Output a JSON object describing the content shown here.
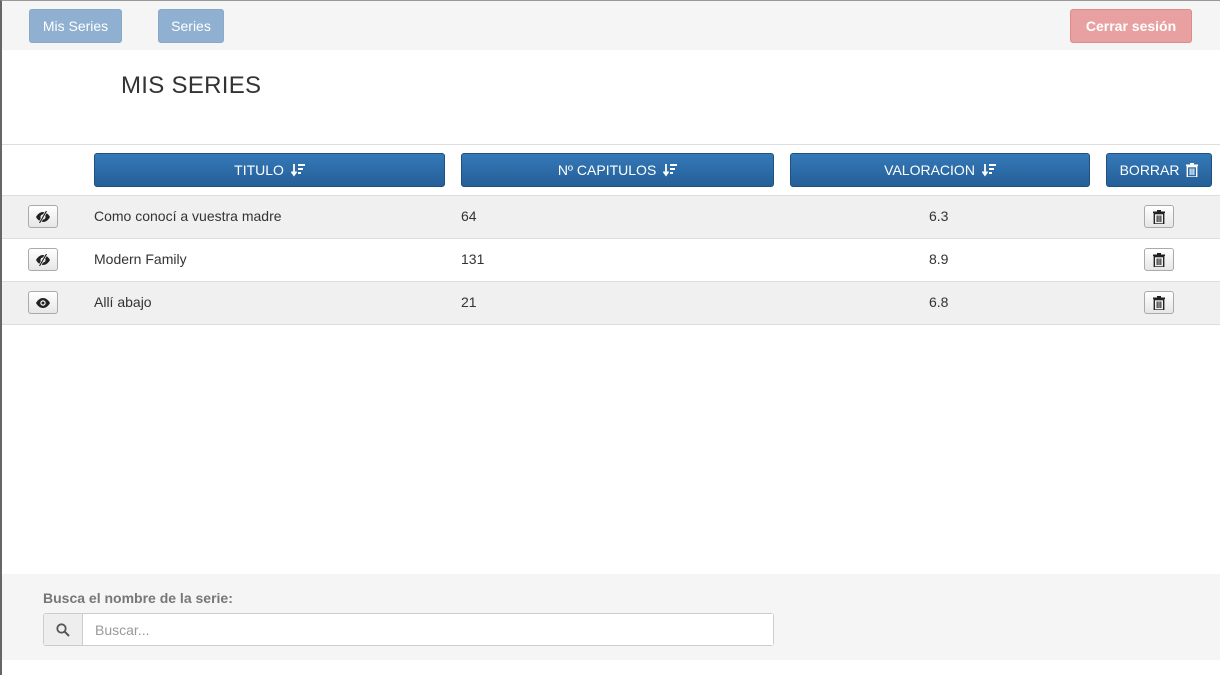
{
  "nav": {
    "mis_series": "Mis Series",
    "series": "Series",
    "logout": "Cerrar sesión"
  },
  "page_title": "MIS SERIES",
  "table": {
    "headers": {
      "titulo": "TITULO",
      "capitulos": "Nº CAPITULOS",
      "valoracion": "VALORACION",
      "borrar": "BORRAR"
    },
    "rows": [
      {
        "title": "Como conocí a vuestra madre",
        "chapters": "64",
        "rating": "6.3",
        "seen": false
      },
      {
        "title": "Modern Family",
        "chapters": "131",
        "rating": "8.9",
        "seen": false
      },
      {
        "title": "Allí abajo",
        "chapters": "21",
        "rating": "6.8",
        "seen": true
      }
    ]
  },
  "search": {
    "label": "Busca el nombre de la serie:",
    "placeholder": "Buscar..."
  },
  "colors": {
    "primary": "#2d6ca8",
    "nav_button": "#8fb0d0",
    "logout_button": "#e8a1a0"
  }
}
